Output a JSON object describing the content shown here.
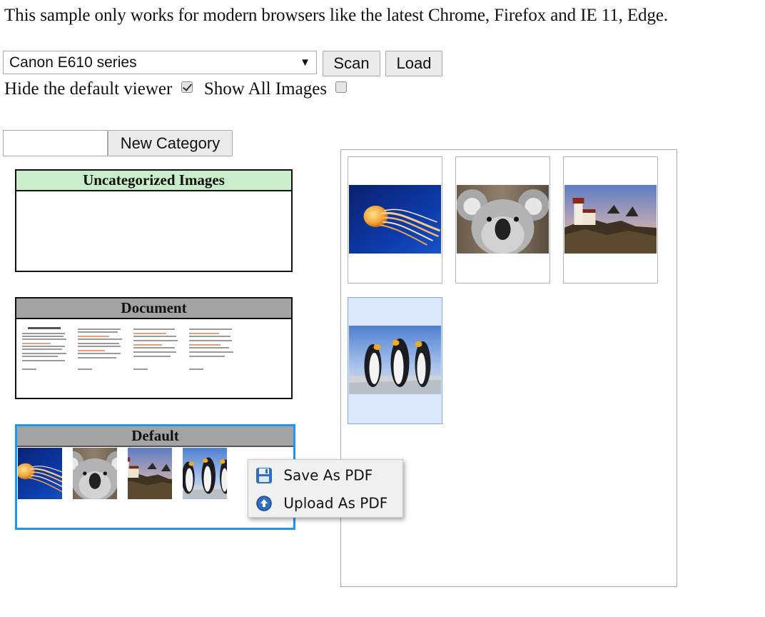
{
  "notice": "This sample only works for modern browsers like the latest Chrome, Firefox and IE 11, Edge.",
  "toolbar": {
    "source_selected": "Canon E610 series",
    "scan_label": "Scan",
    "load_label": "Load"
  },
  "options": {
    "hide_viewer_label": "Hide the default viewer",
    "hide_viewer_checked": true,
    "show_all_label": "Show All Images",
    "show_all_checked": false
  },
  "category_form": {
    "input_value": "",
    "new_category_label": "New Category"
  },
  "categories": [
    {
      "name": "Uncategorized Images",
      "header_color": "#c9ecca",
      "images": []
    },
    {
      "name": "Document",
      "header_color": "#a3a3a3",
      "images": [
        "document-page-1",
        "document-page-2",
        "document-page-3",
        "document-page-4"
      ]
    },
    {
      "name": "Default",
      "header_color": "#a3a3a3",
      "selected": true,
      "images": [
        "jellyfish",
        "koala",
        "lighthouse",
        "penguins"
      ]
    }
  ],
  "viewer": {
    "images": [
      {
        "name": "jellyfish",
        "selected": false
      },
      {
        "name": "koala",
        "selected": false
      },
      {
        "name": "lighthouse",
        "selected": false
      },
      {
        "name": "penguins",
        "selected": true
      }
    ]
  },
  "context_menu": {
    "items": [
      {
        "label": "Save As PDF",
        "icon": "floppy-disk-icon"
      },
      {
        "label": "Upload As PDF",
        "icon": "upload-globe-icon"
      }
    ]
  },
  "colors": {
    "selected_category_border": "#1f97f1",
    "selected_thumb_bg": "#dce8fb"
  }
}
